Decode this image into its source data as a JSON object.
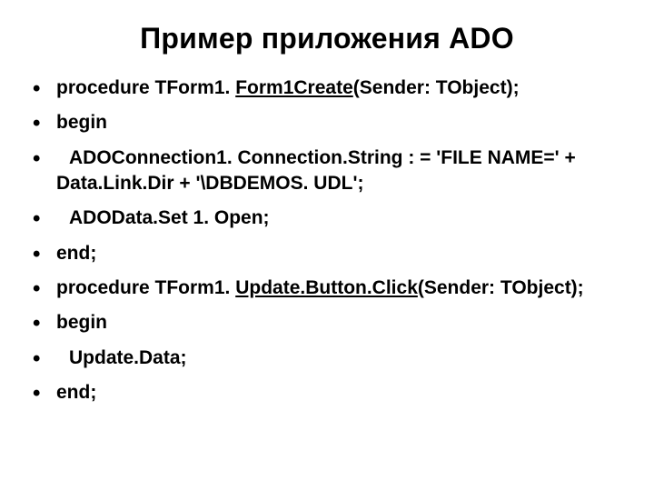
{
  "title": "Пример приложения ADO",
  "line1_prefix": "procedure TForm1. ",
  "line1_under": "Form1Create",
  "line1_suffix": "(Sender: TObject);",
  "line2": "begin",
  "line3": "ADOConnection1. Connection.String : = 'FILE NAME=' + Data.Link.Dir + '\\DBDEMOS. UDL';",
  "line4": "ADOData.Set 1. Open;",
  "line5": "end;",
  "line6_prefix": "procedure TForm1. ",
  "line6_under": "Update.Button.Click",
  "line6_suffix": "(Sender: TObject);",
  "line7": "begin",
  "line8": "Update.Data;",
  "line9": "end;"
}
